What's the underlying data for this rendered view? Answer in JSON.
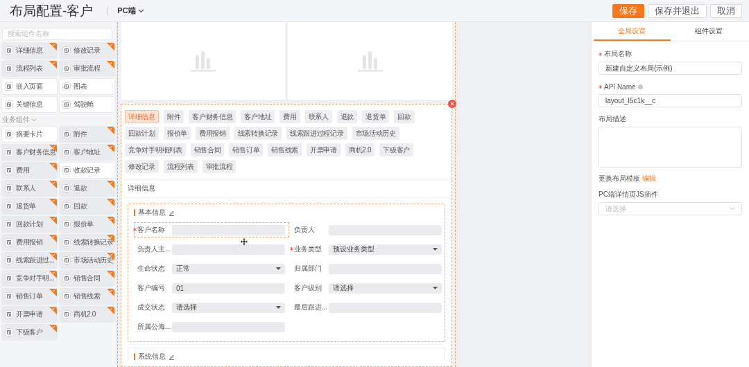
{
  "header": {
    "title": "布局配置-客户",
    "platform": "PC端",
    "buttons": [
      {
        "label": "保存",
        "primary": true
      },
      {
        "label": "保存并退出",
        "primary": false
      },
      {
        "label": "取消",
        "primary": false
      }
    ]
  },
  "component_panel": {
    "search": {
      "placeholder": "搜索组件名称"
    },
    "items": [
      {
        "label": "详细信息",
        "used": true
      },
      {
        "label": "修改记录",
        "used": true
      },
      {
        "label": "流程列表",
        "used": true
      },
      {
        "label": "审批流程",
        "used": true
      },
      {
        "label": "嵌入页面",
        "used": false
      },
      {
        "label": "图表",
        "used": false
      },
      {
        "label": "关键信息",
        "used": false
      },
      {
        "label": "驾驶舱",
        "used": false
      }
    ],
    "business_group": {
      "title": "业务组件",
      "expanded": true,
      "items": [
        {
          "label": "摘要卡片",
          "used": false
        },
        {
          "label": "附件",
          "used": true
        },
        {
          "label": "客户财务信息",
          "used": true
        },
        {
          "label": "客户地址",
          "used": true
        },
        {
          "label": "费用",
          "used": true
        },
        {
          "label": "收款记录",
          "used": false
        },
        {
          "label": "联系人",
          "used": true
        },
        {
          "label": "退款",
          "used": true
        },
        {
          "label": "退货单",
          "used": true
        },
        {
          "label": "回款",
          "used": true
        },
        {
          "label": "回款计划",
          "used": true
        },
        {
          "label": "报价单",
          "used": true
        },
        {
          "label": "费用报销",
          "used": true
        },
        {
          "label": "线索转换记录",
          "used": true
        },
        {
          "label": "线索跟进过...",
          "used": true
        },
        {
          "label": "市场活动历史",
          "used": true
        },
        {
          "label": "竞争对手明...",
          "used": true
        },
        {
          "label": "销售合同",
          "used": true
        },
        {
          "label": "销售订单",
          "used": true
        },
        {
          "label": "销售线索",
          "used": true
        },
        {
          "label": "开票申请",
          "used": true
        },
        {
          "label": "商机2.0",
          "used": true
        },
        {
          "label": "下级客户",
          "used": true
        }
      ]
    }
  },
  "canvas": {
    "chart_placeholders": [
      {
        "kind": "chart"
      },
      {
        "kind": "chart"
      }
    ],
    "detail_component": {
      "selected": true,
      "tabs": [
        {
          "label": "详细信息",
          "selected": true
        },
        {
          "label": "附件",
          "selected": false
        },
        {
          "label": "客户财务信息",
          "selected": false
        },
        {
          "label": "客户地址",
          "selected": false
        },
        {
          "label": "费用",
          "selected": false
        },
        {
          "label": "联系人",
          "selected": false
        },
        {
          "label": "退款",
          "selected": false
        },
        {
          "label": "退货单",
          "selected": false
        },
        {
          "label": "回款",
          "selected": false
        },
        {
          "label": "回款计划",
          "selected": false
        },
        {
          "label": "报价单",
          "selected": false
        },
        {
          "label": "费用报销",
          "selected": false
        },
        {
          "label": "线索转换记录",
          "selected": false
        },
        {
          "label": "线索跟进过程记录",
          "selected": false
        },
        {
          "label": "市场活动历史",
          "selected": false
        },
        {
          "label": "竞争对手明细列表",
          "selected": false
        },
        {
          "label": "销售合同",
          "selected": false
        },
        {
          "label": "销售订单",
          "selected": false
        },
        {
          "label": "销售线索",
          "selected": false
        },
        {
          "label": "开票申请",
          "selected": false
        },
        {
          "label": "商机2.0",
          "selected": false
        },
        {
          "label": "下级客户",
          "selected": false
        },
        {
          "label": "修改记录",
          "selected": false
        },
        {
          "label": "流程列表",
          "selected": false
        },
        {
          "label": "审批流程",
          "selected": false
        }
      ],
      "title": "详细信息",
      "sections": [
        {
          "title": "基本信息",
          "fields": [
            {
              "label": "客户名称",
              "required": true,
              "kind": "text",
              "selected": true
            },
            {
              "label": "负责人",
              "required": false,
              "kind": "text",
              "selected": false
            },
            {
              "label": "负责人主...",
              "required": false,
              "kind": "text",
              "selected": false
            },
            {
              "label": "业务类型",
              "required": true,
              "kind": "select",
              "value": "预设业务类型",
              "selected": false
            },
            {
              "label": "生命状态",
              "required": false,
              "kind": "select",
              "value": "正常",
              "selected": false
            },
            {
              "label": "归属部门",
              "required": false,
              "kind": "text",
              "selected": false
            },
            {
              "label": "客户编号",
              "required": false,
              "kind": "text",
              "value": "01",
              "selected": false
            },
            {
              "label": "客户级别",
              "required": false,
              "kind": "select",
              "value": "请选择",
              "selected": false
            },
            {
              "label": "成交状态",
              "required": false,
              "kind": "select",
              "value": "请选择",
              "selected": false
            },
            {
              "label": "最后跟进...",
              "required": false,
              "kind": "text",
              "selected": false
            },
            {
              "label": "所属公海...",
              "required": false,
              "kind": "text",
              "selected": false
            }
          ]
        },
        {
          "title": "系统信息"
        }
      ]
    }
  },
  "settings_panel": {
    "tabs": [
      {
        "label": "全局设置",
        "selected": true
      },
      {
        "label": "组件设置",
        "selected": false
      }
    ],
    "fields": [
      {
        "label": "布局名称",
        "required": true,
        "help": false,
        "kind": "text",
        "value": "新建自定义布局(示例)"
      },
      {
        "label": "API Name",
        "required": true,
        "help": true,
        "kind": "text",
        "value": "layout_I5c1k__c"
      },
      {
        "label": "布局描述",
        "required": false,
        "help": false,
        "kind": "textarea"
      }
    ],
    "template": {
      "label": "更换布局模板",
      "link": "编辑"
    },
    "plugin": {
      "label": "PC端详情页JS插件",
      "placeholder": "请选择"
    }
  }
}
